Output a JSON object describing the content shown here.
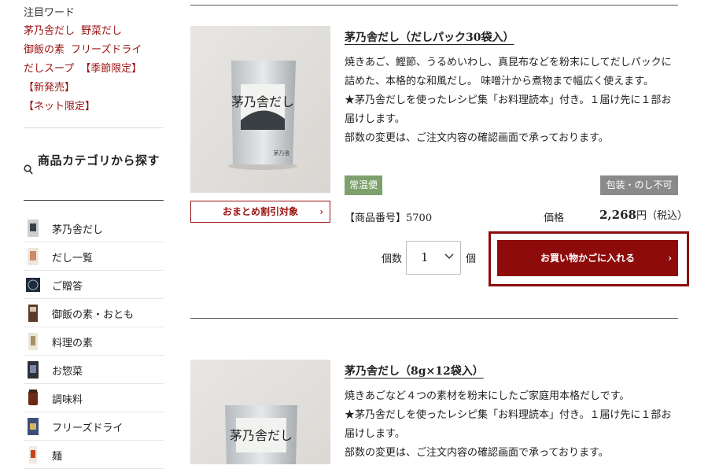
{
  "sidebar": {
    "keywords_title": "注目ワード",
    "keyword_lines": [
      [
        "茅乃舎だし",
        "野菜だし"
      ],
      [
        "御飯の素",
        "フリーズドライ"
      ],
      [
        "だしスープ",
        "【季節限定】"
      ],
      [
        "【新発売】"
      ],
      [
        "【ネット限定】"
      ]
    ],
    "category_title": "商品カテゴリから探す",
    "categories": [
      {
        "label": "茅乃舎だし"
      },
      {
        "label": "だし一覧"
      },
      {
        "label": "ご贈答"
      },
      {
        "label": "御飯の素・おとも"
      },
      {
        "label": "料理の素"
      },
      {
        "label": "お惣菜"
      },
      {
        "label": "調味料"
      },
      {
        "label": "フリーズドライ"
      },
      {
        "label": "麺"
      }
    ]
  },
  "products": [
    {
      "title": "茅乃舎だし（だしパック30袋入）",
      "desc": [
        "焼きあご、鰹節、うるめいわし、真昆布などを粉末にしてだしパックに詰めた、本格的な和風だし。 味噌汁から煮物まで幅広く使えます。",
        "★茅乃舎だしを使ったレシピ集「お料理読本」付き。１届け先に１部お届けします。",
        "部数の変更は、ご注文内容の確認画面で承っております。"
      ],
      "badge_temp": "常温便",
      "badge_wrap": "包装・のし不可",
      "matome_label": "おまとめ割引対象",
      "sku": "【商品番号】5700",
      "price_label": "価格",
      "price": "2,268",
      "price_unit": "円（税込）",
      "qty_label": "個数",
      "qty_value": "1",
      "qty_unit": "個",
      "cart_label": "お買い物かごに入れる"
    },
    {
      "title": "茅乃舎だし（8g×12袋入）",
      "desc": [
        "焼きあごなど４つの素材を粉末にしたご家庭用本格だしです。",
        "★茅乃舎だしを使ったレシピ集「お料理読本」付き。１届け先に１部お届けします。",
        "部数の変更は、ご注文内容の確認画面で承っております。"
      ]
    }
  ],
  "colors": {
    "accent_red": "#9b1111",
    "cart_red": "#8e0b0b",
    "badge_green": "#7ea06d",
    "badge_gray": "#8a8a8a"
  }
}
